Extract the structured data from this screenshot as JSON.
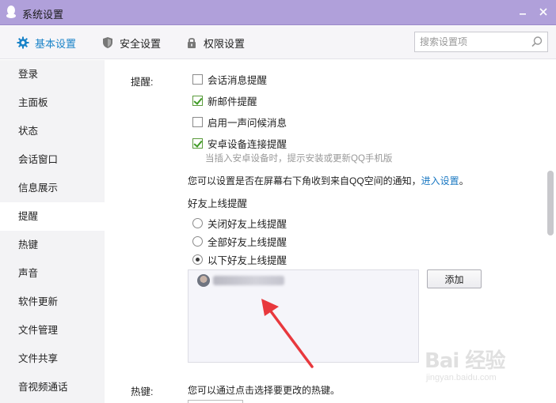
{
  "window": {
    "title": "系统设置"
  },
  "tabs": [
    {
      "label": "基本设置",
      "icon": "gear-icon",
      "active": true
    },
    {
      "label": "安全设置",
      "icon": "shield-icon"
    },
    {
      "label": "权限设置",
      "icon": "lock-icon"
    }
  ],
  "search": {
    "placeholder": "搜索设置项",
    "value": ""
  },
  "sidebar": {
    "items": [
      {
        "label": "登录"
      },
      {
        "label": "主面板"
      },
      {
        "label": "状态"
      },
      {
        "label": "会话窗口"
      },
      {
        "label": "信息展示"
      },
      {
        "label": "提醒",
        "active": true
      },
      {
        "label": "热键"
      },
      {
        "label": "声音"
      },
      {
        "label": "软件更新"
      },
      {
        "label": "文件管理"
      },
      {
        "label": "文件共享"
      },
      {
        "label": "音视频通话"
      }
    ]
  },
  "reminder": {
    "label": "提醒:",
    "options": [
      {
        "label": "会话消息提醒",
        "checked": false
      },
      {
        "label": "新邮件提醒",
        "checked": true
      },
      {
        "label": "启用一声问候消息",
        "checked": false
      },
      {
        "label": "安卓设备连接提醒",
        "checked": true
      }
    ],
    "hint": "当插入安卓设备时，提示安装或更新QQ手机版",
    "qzone_text": "您可以设置是否在屏幕右下角收到来自QQ空间的通知，",
    "qzone_link": "进入设置",
    "qzone_end": "。"
  },
  "friend_online": {
    "heading": "好友上线提醒",
    "options": [
      {
        "label": "关闭好友上线提醒",
        "selected": false
      },
      {
        "label": "全部好友上线提醒",
        "selected": false
      },
      {
        "label": "以下好友上线提醒",
        "selected": true
      }
    ],
    "add_button": "添加"
  },
  "hotkey": {
    "label": "热键:",
    "description": "您可以通过点击选择要更改的热键。"
  },
  "watermark": {
    "main": "Bai 经验",
    "sub": "jingyan.baidu.com"
  },
  "colors": {
    "accent": "#1a83c8",
    "titlebar": "#b0a0da",
    "link": "#1a78c2",
    "check": "#3f9b25",
    "arrow": "#e8383d"
  }
}
